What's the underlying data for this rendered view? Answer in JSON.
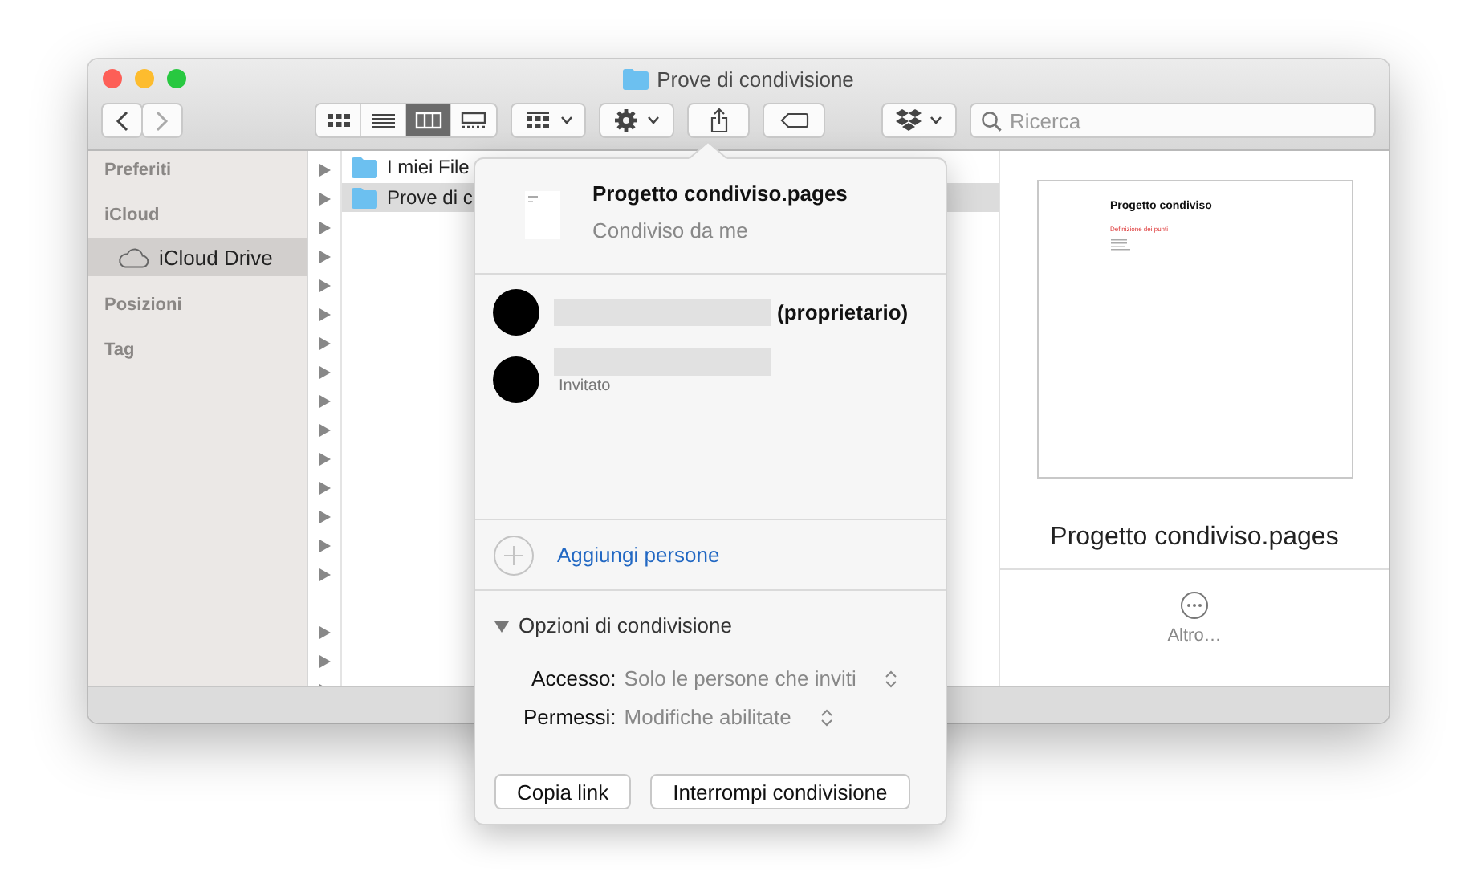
{
  "window": {
    "title": "Prove di condivisione"
  },
  "toolbar": {
    "view_modes": [
      {
        "selected": false
      },
      {
        "selected": false
      },
      {
        "selected": true
      },
      {
        "selected": false
      }
    ],
    "search": {
      "placeholder": "Ricerca"
    }
  },
  "sidebar": {
    "sections": [
      {
        "title": "Preferiti"
      },
      {
        "title": "iCloud",
        "items": [
          {
            "label": "iCloud Drive",
            "selected": true
          }
        ]
      },
      {
        "title": "Posizioni"
      },
      {
        "title": "Tag"
      }
    ]
  },
  "columns": {
    "items": [
      {
        "name": "I miei File",
        "selected": false
      },
      {
        "name": "Prove di c",
        "selected": true
      }
    ]
  },
  "share_popover": {
    "file_name": "Progetto condiviso.pages",
    "subtitle": "Condiviso da me",
    "participants": [
      {
        "kind": "owner",
        "role": "(proprietario)"
      },
      {
        "kind": "invitee",
        "role": "Invitato"
      }
    ],
    "add_people": "Aggiungi persone",
    "options": {
      "title": "Opzioni di condivisione",
      "expanded": true,
      "rows": [
        {
          "label": "Accesso:",
          "value": "Solo le persone che inviti"
        },
        {
          "label": "Permessi:",
          "value": "Modifiche abilitate"
        }
      ]
    },
    "buttons": [
      "Copia link",
      "Interrompi condivisione"
    ]
  },
  "preview": {
    "document": {
      "title": "Progetto condiviso",
      "heading": "Definizione dei punti"
    },
    "file_name": "Progetto condiviso.pages",
    "action": "Altro…"
  }
}
